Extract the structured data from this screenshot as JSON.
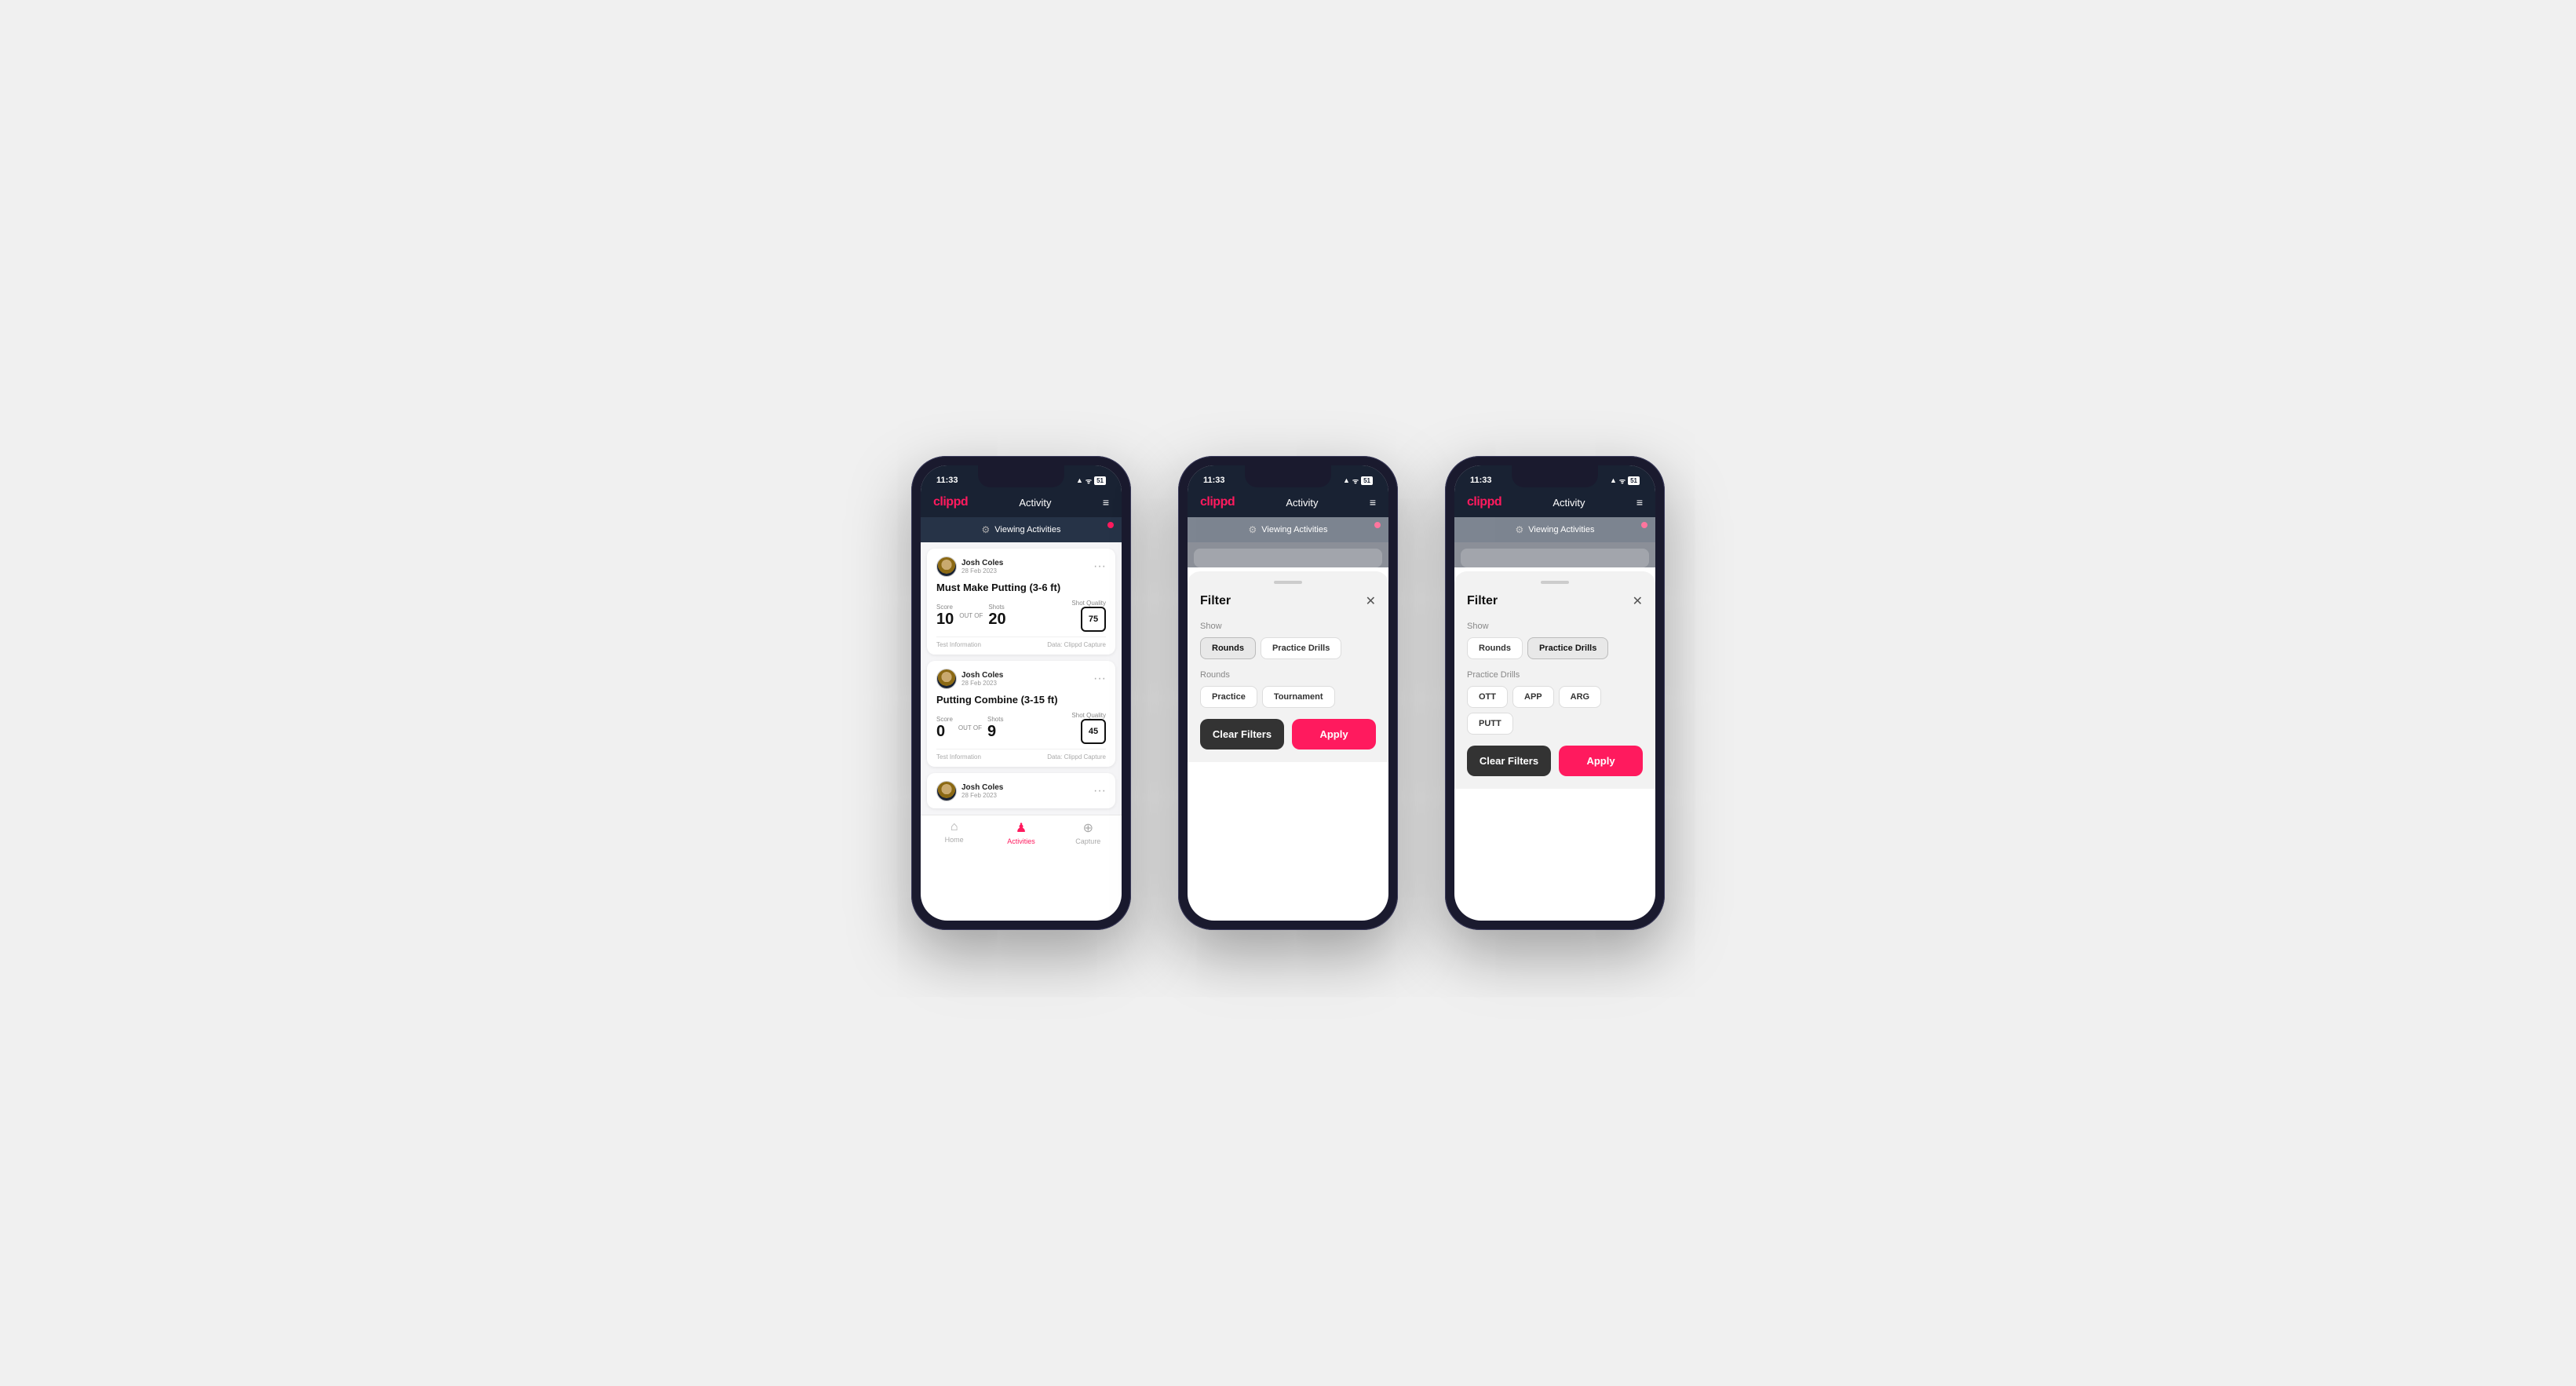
{
  "phones": [
    {
      "id": "phone1",
      "type": "activity",
      "statusBar": {
        "time": "11:33",
        "icons": "▲ ᯤ ⬛"
      },
      "header": {
        "logo": "clippd",
        "title": "Activity",
        "menuIcon": "≡"
      },
      "viewingBar": {
        "icon": "⚙",
        "text": "Viewing Activities"
      },
      "cards": [
        {
          "userName": "Josh Coles",
          "userDate": "28 Feb 2023",
          "title": "Must Make Putting (3-6 ft)",
          "scoreLabel": "Score",
          "scoreValue": "10",
          "outOfLabel": "OUT OF",
          "outOfValue": "20",
          "shotsLabel": "Shots",
          "qualityLabel": "Shot Quality",
          "qualityValue": "75",
          "infoLabel": "Test Information",
          "dataLabel": "Data: Clippd Capture"
        },
        {
          "userName": "Josh Coles",
          "userDate": "28 Feb 2023",
          "title": "Putting Combine (3-15 ft)",
          "scoreLabel": "Score",
          "scoreValue": "0",
          "outOfLabel": "OUT OF",
          "outOfValue": "9",
          "shotsLabel": "Shots",
          "qualityLabel": "Shot Quality",
          "qualityValue": "45",
          "infoLabel": "Test Information",
          "dataLabel": "Data: Clippd Capture"
        },
        {
          "userName": "Josh Coles",
          "userDate": "28 Feb 2023",
          "title": "",
          "scoreLabel": "",
          "scoreValue": "",
          "outOfLabel": "",
          "outOfValue": "",
          "shotsLabel": "",
          "qualityLabel": "",
          "qualityValue": "",
          "infoLabel": "",
          "dataLabel": ""
        }
      ],
      "bottomNav": [
        {
          "icon": "🏠",
          "label": "Home",
          "active": false
        },
        {
          "icon": "👤",
          "label": "Activities",
          "active": true
        },
        {
          "icon": "➕",
          "label": "Capture",
          "active": false
        }
      ]
    },
    {
      "id": "phone2",
      "type": "filter",
      "statusBar": {
        "time": "11:33",
        "icons": "▲ ᯤ ⬛"
      },
      "header": {
        "logo": "clippd",
        "title": "Activity",
        "menuIcon": "≡"
      },
      "viewingBar": {
        "icon": "⚙",
        "text": "Viewing Activities"
      },
      "filter": {
        "title": "Filter",
        "closeIcon": "✕",
        "showLabel": "Show",
        "showOptions": [
          {
            "label": "Rounds",
            "active": true
          },
          {
            "label": "Practice Drills",
            "active": false
          }
        ],
        "roundsLabel": "Rounds",
        "roundOptions": [
          {
            "label": "Practice",
            "active": false
          },
          {
            "label": "Tournament",
            "active": false
          }
        ],
        "clearLabel": "Clear Filters",
        "applyLabel": "Apply"
      }
    },
    {
      "id": "phone3",
      "type": "filter2",
      "statusBar": {
        "time": "11:33",
        "icons": "▲ ᯤ ⬛"
      },
      "header": {
        "logo": "clippd",
        "title": "Activity",
        "menuIcon": "≡"
      },
      "viewingBar": {
        "icon": "⚙",
        "text": "Viewing Activities"
      },
      "filter": {
        "title": "Filter",
        "closeIcon": "✕",
        "showLabel": "Show",
        "showOptions": [
          {
            "label": "Rounds",
            "active": false
          },
          {
            "label": "Practice Drills",
            "active": true
          }
        ],
        "practiceLabel": "Practice Drills",
        "practiceOptions": [
          {
            "label": "OTT",
            "active": false
          },
          {
            "label": "APP",
            "active": false
          },
          {
            "label": "ARG",
            "active": false
          },
          {
            "label": "PUTT",
            "active": false
          }
        ],
        "clearLabel": "Clear Filters",
        "applyLabel": "Apply"
      }
    }
  ]
}
